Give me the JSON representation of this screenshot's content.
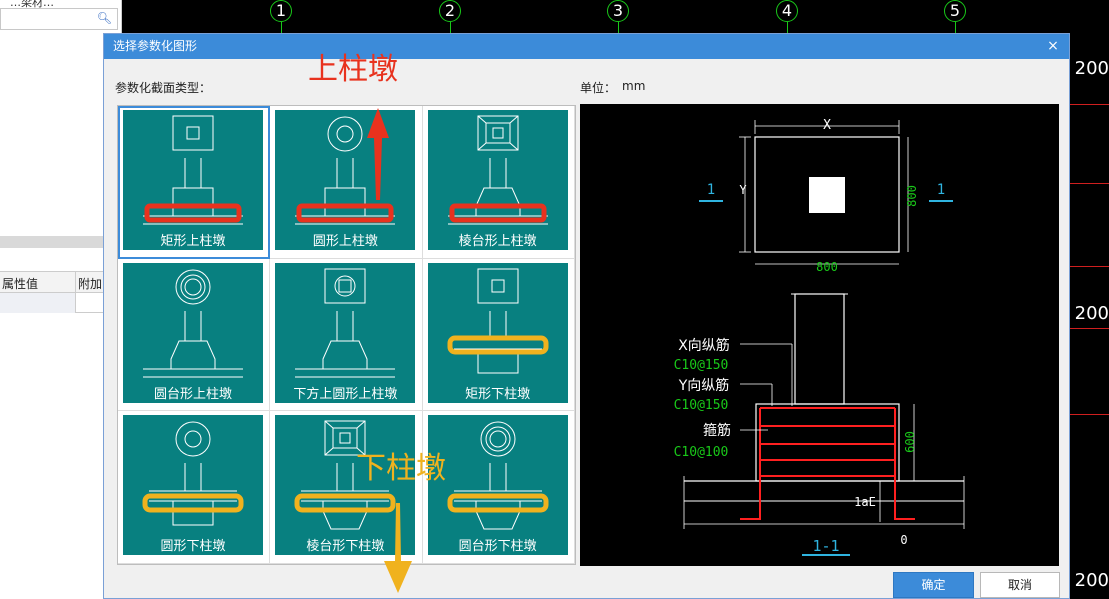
{
  "colors": {
    "dialog_title_bg": "#3c8bd9",
    "tile_bg": "#088080",
    "annotation_red": "#e8321e",
    "annotation_yellow": "#f0b21e",
    "cad_green": "#19c819"
  },
  "left_panel": {
    "top_text": "…梁材…",
    "search_icon": "search-icon",
    "columns": [
      "属性值",
      "附加"
    ]
  },
  "cad": {
    "axis_labels": [
      "1",
      "2",
      "3",
      "4",
      "5"
    ],
    "right_labels": [
      "200",
      "200",
      "200"
    ]
  },
  "dialog": {
    "title": "选择参数化图形",
    "close_glyph": "×",
    "section_type_label": "参数化截面类型：",
    "unit_label": "单位：",
    "unit_value": "mm",
    "tiles": [
      {
        "label": "矩形上柱墩",
        "kind": "rect-top"
      },
      {
        "label": "圆形上柱墩",
        "kind": "circle-top"
      },
      {
        "label": "棱台形上柱墩",
        "kind": "frustum-top"
      },
      {
        "label": "圆台形上柱墩",
        "kind": "cone-top"
      },
      {
        "label": "下方上圆形上柱墩",
        "kind": "square-circle-top"
      },
      {
        "label": "矩形下柱墩",
        "kind": "rect-bottom"
      },
      {
        "label": "圆形下柱墩",
        "kind": "circle-bottom"
      },
      {
        "label": "棱台形下柱墩",
        "kind": "frustum-bottom"
      },
      {
        "label": "圆台形下柱墩",
        "kind": "cone-bottom"
      }
    ],
    "selected_index": 0,
    "preview": {
      "dim_x": "X",
      "dim_y": "Y",
      "dim_800_h": "800",
      "dim_800_v": "800",
      "section_mark": "1",
      "dim_600": "600",
      "x_rebar_label": "X向纵筋",
      "x_rebar_value": "C10@150",
      "y_rebar_label": "Y向纵筋",
      "y_rebar_value": "C10@150",
      "stirrup_label": "箍筋",
      "stirrup_value": "C10@100",
      "anchor_label": "1aE",
      "zero_label": "0",
      "section_title": "1-1"
    },
    "ok_label": "确定",
    "cancel_label": "取消"
  },
  "annotations": {
    "top_text": "上柱墩",
    "bottom_text": "下柱墩"
  }
}
